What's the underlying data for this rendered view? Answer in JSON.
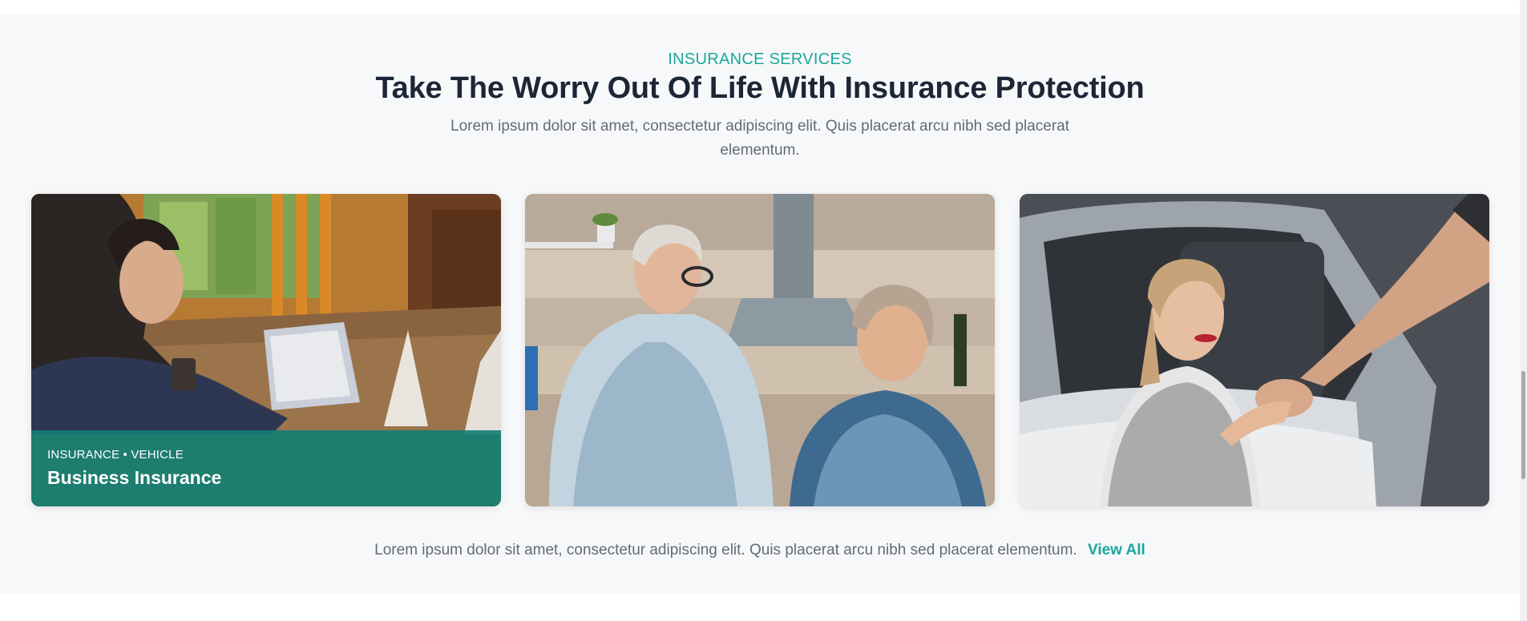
{
  "section": {
    "eyebrow": "INSURANCE SERVICES",
    "title": "Take The Worry Out Of Life With Insurance Protection",
    "description": "Lorem ipsum dolor sit amet, consectetur adipiscing elit. Quis placerat arcu nibh sed placerat elementum."
  },
  "cards": [
    {
      "image": "woman-working-on-laptop-photo",
      "tags": "INSURANCE • VEHICLE",
      "title": "Business Insurance"
    },
    {
      "image": "senior-couple-in-kitchen-photo"
    },
    {
      "image": "woman-in-car-handshake-photo"
    }
  ],
  "footer": {
    "text": "Lorem ipsum dolor sit amet, consectetur adipiscing elit. Quis placerat arcu nibh sed placerat elementum.",
    "link_label": "View All"
  },
  "colors": {
    "accent": "#1aa89a",
    "heading": "#1c2636",
    "body_text": "#646b75",
    "section_bg": "#f7f8fa",
    "overlay": "#118074"
  }
}
